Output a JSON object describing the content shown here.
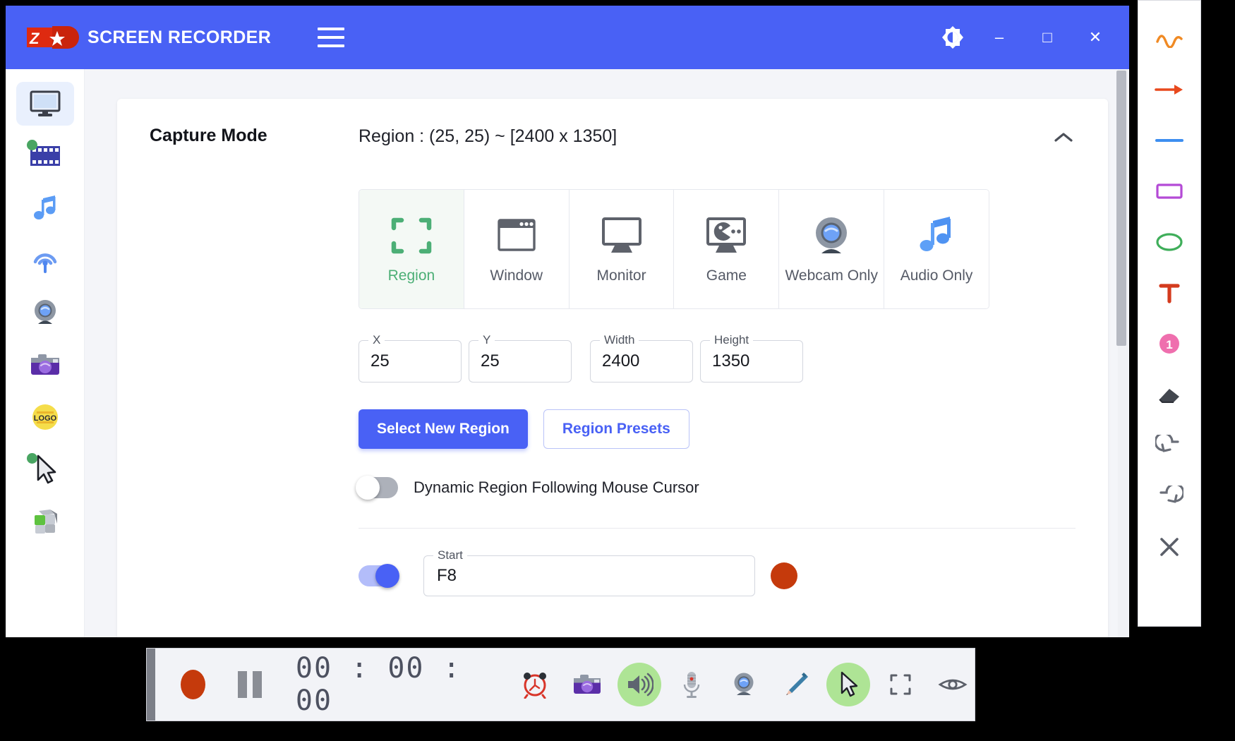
{
  "window": {
    "brand_logo": "zd-logo",
    "title": "SCREEN RECORDER",
    "menu_icon": "hamburger-menu-icon",
    "theme_icon": "brightness-icon",
    "minimize": "–",
    "maximize": "□",
    "close": "✕",
    "accent_color": "#4961f5"
  },
  "sidebar": {
    "items": [
      {
        "name": "screen-recorder",
        "icon": "monitor-icon",
        "active": true,
        "badge": false
      },
      {
        "name": "video-recorder",
        "icon": "film-strip-icon",
        "active": false,
        "badge": true
      },
      {
        "name": "audio-recorder",
        "icon": "music-note-icon",
        "active": false,
        "badge": false
      },
      {
        "name": "streaming",
        "icon": "broadcast-icon",
        "active": false,
        "badge": false
      },
      {
        "name": "webcam",
        "icon": "webcam-icon",
        "active": false,
        "badge": false
      },
      {
        "name": "screenshot",
        "icon": "camera-icon",
        "active": false,
        "badge": false
      },
      {
        "name": "watermark",
        "icon": "logo-badge-icon",
        "active": false,
        "badge": false
      },
      {
        "name": "mouse-effects",
        "icon": "cursor-icon",
        "active": false,
        "badge": true
      },
      {
        "name": "keystrokes",
        "icon": "keyboard-keys-icon",
        "active": false,
        "badge": false
      }
    ]
  },
  "capture": {
    "section_title": "Capture Mode",
    "region_summary": "Region : (25, 25) ~ [2400 x 1350]",
    "collapse_icon": "chevron-up-icon",
    "modes": [
      {
        "label": "Region",
        "icon": "crop-brackets-icon",
        "selected": true
      },
      {
        "label": "Window",
        "icon": "window-icon",
        "selected": false
      },
      {
        "label": "Monitor",
        "icon": "monitor-icon",
        "selected": false
      },
      {
        "label": "Game",
        "icon": "game-pacman-icon",
        "selected": false
      },
      {
        "label": "Webcam Only",
        "icon": "webcam-icon",
        "selected": false
      },
      {
        "label": "Audio Only",
        "icon": "music-note-icon",
        "selected": false
      }
    ],
    "selected_color": "#4caf76",
    "fields": [
      {
        "label": "X",
        "value": "25"
      },
      {
        "label": "Y",
        "value": "25"
      },
      {
        "label": "Width",
        "value": "2400"
      },
      {
        "label": "Height",
        "value": "1350"
      }
    ],
    "buttons": {
      "select_new_region": "Select New Region",
      "region_presets": "Region Presets"
    },
    "dynamic_region": {
      "label": "Dynamic Region Following Mouse Cursor",
      "on": false
    },
    "hotkey": {
      "enabled": true,
      "legend": "Start",
      "value": "F8",
      "record_button": "record-hotkey-button"
    }
  },
  "annotation_toolbar": {
    "tools": [
      {
        "name": "freehand-curve-tool",
        "glyph": "∿",
        "color": "#f08a24"
      },
      {
        "name": "arrow-tool",
        "glyph": "→",
        "color": "#e8491d"
      },
      {
        "name": "line-tool",
        "glyph": "—",
        "color": "#3d8ef0"
      },
      {
        "name": "rectangle-tool",
        "glyph": "▭",
        "color": "#b44ad6"
      },
      {
        "name": "ellipse-tool",
        "glyph": "◯",
        "color": "#3fae5a"
      },
      {
        "name": "text-tool",
        "glyph": "T",
        "color": "#d43b1e"
      },
      {
        "name": "step-number-tool",
        "glyph": "1",
        "color": "#ef6fae"
      },
      {
        "name": "eraser-tool",
        "glyph": "◢",
        "color": "#43474f"
      },
      {
        "name": "undo-button",
        "glyph": "↶",
        "color": "#6a6e78"
      },
      {
        "name": "redo-button",
        "glyph": "↷",
        "color": "#6a6e78"
      },
      {
        "name": "close-toolbar-button",
        "glyph": "✕",
        "color": "#5b5f69"
      }
    ]
  },
  "control_bar": {
    "record": "record-button",
    "pause": "pause-button",
    "timer": "00 : 00 : 00",
    "icons": [
      {
        "name": "scheduler-alarm-button",
        "icon": "alarm-clock-icon",
        "highlighted": false
      },
      {
        "name": "screenshot-button",
        "icon": "camera-icon",
        "highlighted": false
      },
      {
        "name": "system-sound-button",
        "icon": "speaker-icon",
        "highlighted": true
      },
      {
        "name": "microphone-button",
        "icon": "microphone-icon",
        "highlighted": false
      },
      {
        "name": "webcam-button",
        "icon": "webcam-icon",
        "highlighted": false
      },
      {
        "name": "annotation-pen-button",
        "icon": "pencil-icon",
        "highlighted": false
      },
      {
        "name": "cursor-effects-button",
        "icon": "cursor-icon",
        "highlighted": true
      },
      {
        "name": "fullscreen-button",
        "icon": "expand-icon",
        "highlighted": false
      },
      {
        "name": "preview-button",
        "icon": "eye-icon",
        "highlighted": false
      }
    ]
  }
}
